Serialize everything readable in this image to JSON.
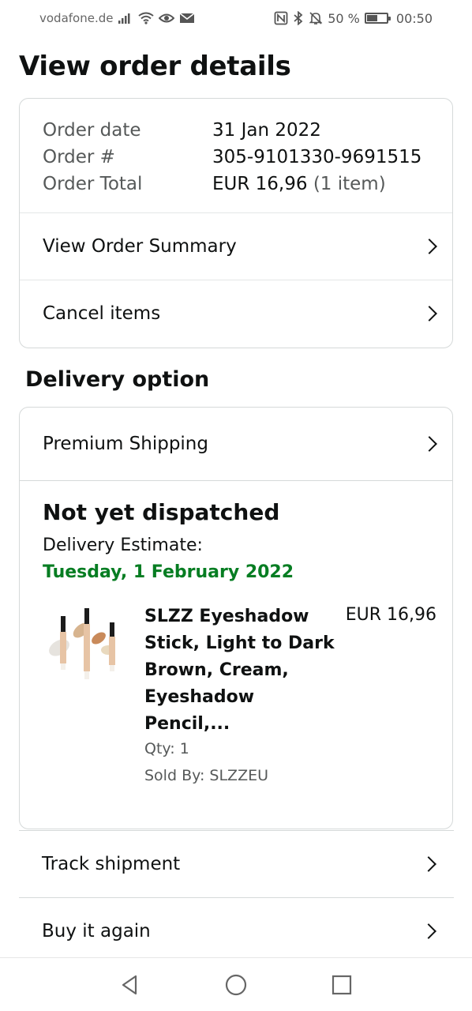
{
  "status_bar": {
    "carrier": "vodafone.de",
    "battery_percent": "50 %",
    "time": "00:50",
    "icons": [
      "signal-icon",
      "wifi-icon",
      "eye-icon",
      "mail-icon",
      "nfc-icon",
      "bluetooth-icon",
      "mute-icon",
      "battery-icon"
    ]
  },
  "page": {
    "title": "View order details"
  },
  "order": {
    "date_label": "Order date",
    "date_value": "31 Jan 2022",
    "number_label": "Order #",
    "number_value": "305-9101330-9691515",
    "total_label": "Order Total",
    "total_value": "EUR 16,96",
    "total_items": "(1 item)",
    "summary_link": "View Order Summary",
    "cancel_link": "Cancel items"
  },
  "delivery": {
    "section_title": "Delivery option",
    "shipping_method": "Premium Shipping",
    "status": "Not yet dispatched",
    "estimate_label": "Delivery Estimate:",
    "estimate_date": "Tuesday, 1 February 2022",
    "estimate_color": "#067d22"
  },
  "product": {
    "title": "SLZZ Eyeshadow Stick, Light to Dark Brown, Cream, Eyeshadow Pencil,...",
    "price": "EUR 16,96",
    "qty": "Qty: 1",
    "seller": "Sold By: SLZZEU"
  },
  "actions": {
    "track": "Track shipment",
    "buy_again": "Buy it again"
  },
  "nav": {
    "buttons": [
      "back-icon",
      "home-icon",
      "recents-icon"
    ]
  }
}
